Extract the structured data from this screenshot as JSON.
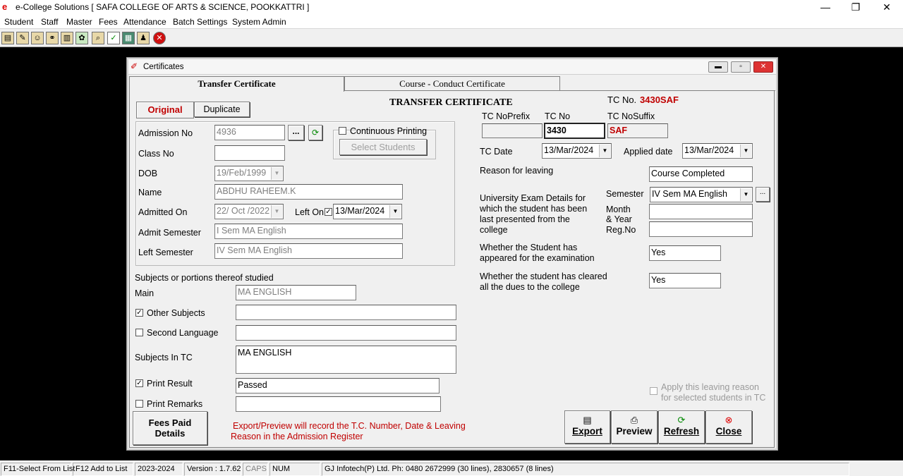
{
  "app": {
    "title": "e-College Solutions [ SAFA COLLEGE OF ARTS & SCIENCE, POOKKATTRI ]",
    "window_controls": [
      "—",
      "❐",
      "✕"
    ]
  },
  "menu": [
    "Student",
    "Staff",
    "Master",
    "Fees",
    "Attendance",
    "Batch Settings",
    "System Admin"
  ],
  "child": {
    "title": "Certificates",
    "tabs": [
      "Transfer Certificate",
      "Course - Conduct Certificate"
    ],
    "sub_tabs": [
      "Original",
      "Duplicate"
    ],
    "heading": "TRANSFER CERTIFICATE",
    "tc_no_label": "TC No.",
    "tc_no_value": "3430SAF"
  },
  "left": {
    "admission_no_label": "Admission No",
    "admission_no": "4936",
    "more_btn": "...",
    "continuous_printing": "Continuous Printing",
    "select_students": "Select Students",
    "class_no_label": "Class No",
    "class_no": "",
    "dob_label": "DOB",
    "dob": "19/Feb/1999",
    "name_label": "Name",
    "name": "ABDHU RAHEEM.K",
    "admitted_on_label": "Admitted On",
    "admitted_on": "22/ Oct /2022",
    "left_on_label": "Left On",
    "left_on": "13/Mar/2024",
    "admit_sem_label": "Admit Semester",
    "admit_sem": "I Sem MA English",
    "left_sem_label": "Left Semester",
    "left_sem": "IV Sem MA English",
    "subjects_label": "Subjects or portions thereof studied",
    "main_label": "Main",
    "main": "MA ENGLISH",
    "other_subjects_label": "Other Subjects",
    "other_subjects": "",
    "second_lang_label": "Second Language",
    "second_lang": "",
    "subjects_in_tc_label": "Subjects In TC",
    "subjects_in_tc": "MA ENGLISH",
    "print_result_label": "Print Result",
    "print_result": "Passed",
    "print_remarks_label": "Print Remarks",
    "print_remarks": "",
    "fees_paid_line1": "Fees Paid",
    "fees_paid_line2": "Details",
    "note_line1": "Export/Preview will record the T.C. Number, Date & Leaving",
    "note_line2": "Reason in the Admission Register"
  },
  "right": {
    "tc_prefix_label": "TC NoPrefix",
    "tc_prefix": "",
    "tc_no_label": "TC No",
    "tc_no": "3430",
    "tc_suffix_label": "TC NoSuffix",
    "tc_suffix": "SAF",
    "tc_date_label": "TC Date",
    "tc_date": "13/Mar/2024",
    "applied_date_label": "Applied date",
    "applied_date": "13/Mar/2024",
    "reason_label": "Reason for leaving",
    "reason": "Course Completed",
    "univ_label_1": "University Exam Details for",
    "univ_label_2": "which the student has been",
    "univ_label_3": "last presented from the",
    "univ_label_4": "college",
    "semester_label": "Semester",
    "semester": "IV Sem MA English",
    "month_label_1": "Month",
    "month_label_2": "& Year",
    "month_year": "",
    "regno_label": "Reg.No",
    "regno": "",
    "appeared_label_1": "Whether the Student has",
    "appeared_label_2": "appeared for the examination",
    "appeared": "Yes",
    "cleared_label_1": "Whether the student has cleared",
    "cleared_label_2": "all the dues to the college",
    "cleared": "Yes",
    "apply_reason_1": "Apply this leaving reason",
    "apply_reason_2": "for selected students in TC"
  },
  "actions": {
    "export": "Export",
    "preview": "Preview",
    "refresh": "Refresh",
    "close": "Close"
  },
  "status": [
    "F11-Select From List",
    "F12 Add to List",
    "2023-2024",
    "Version : 1.7.62",
    "CAPS",
    "NUM",
    "GJ Infotech(P) Ltd. Ph: 0480 2672999 (30 lines), 2830657 (8 lines)"
  ]
}
